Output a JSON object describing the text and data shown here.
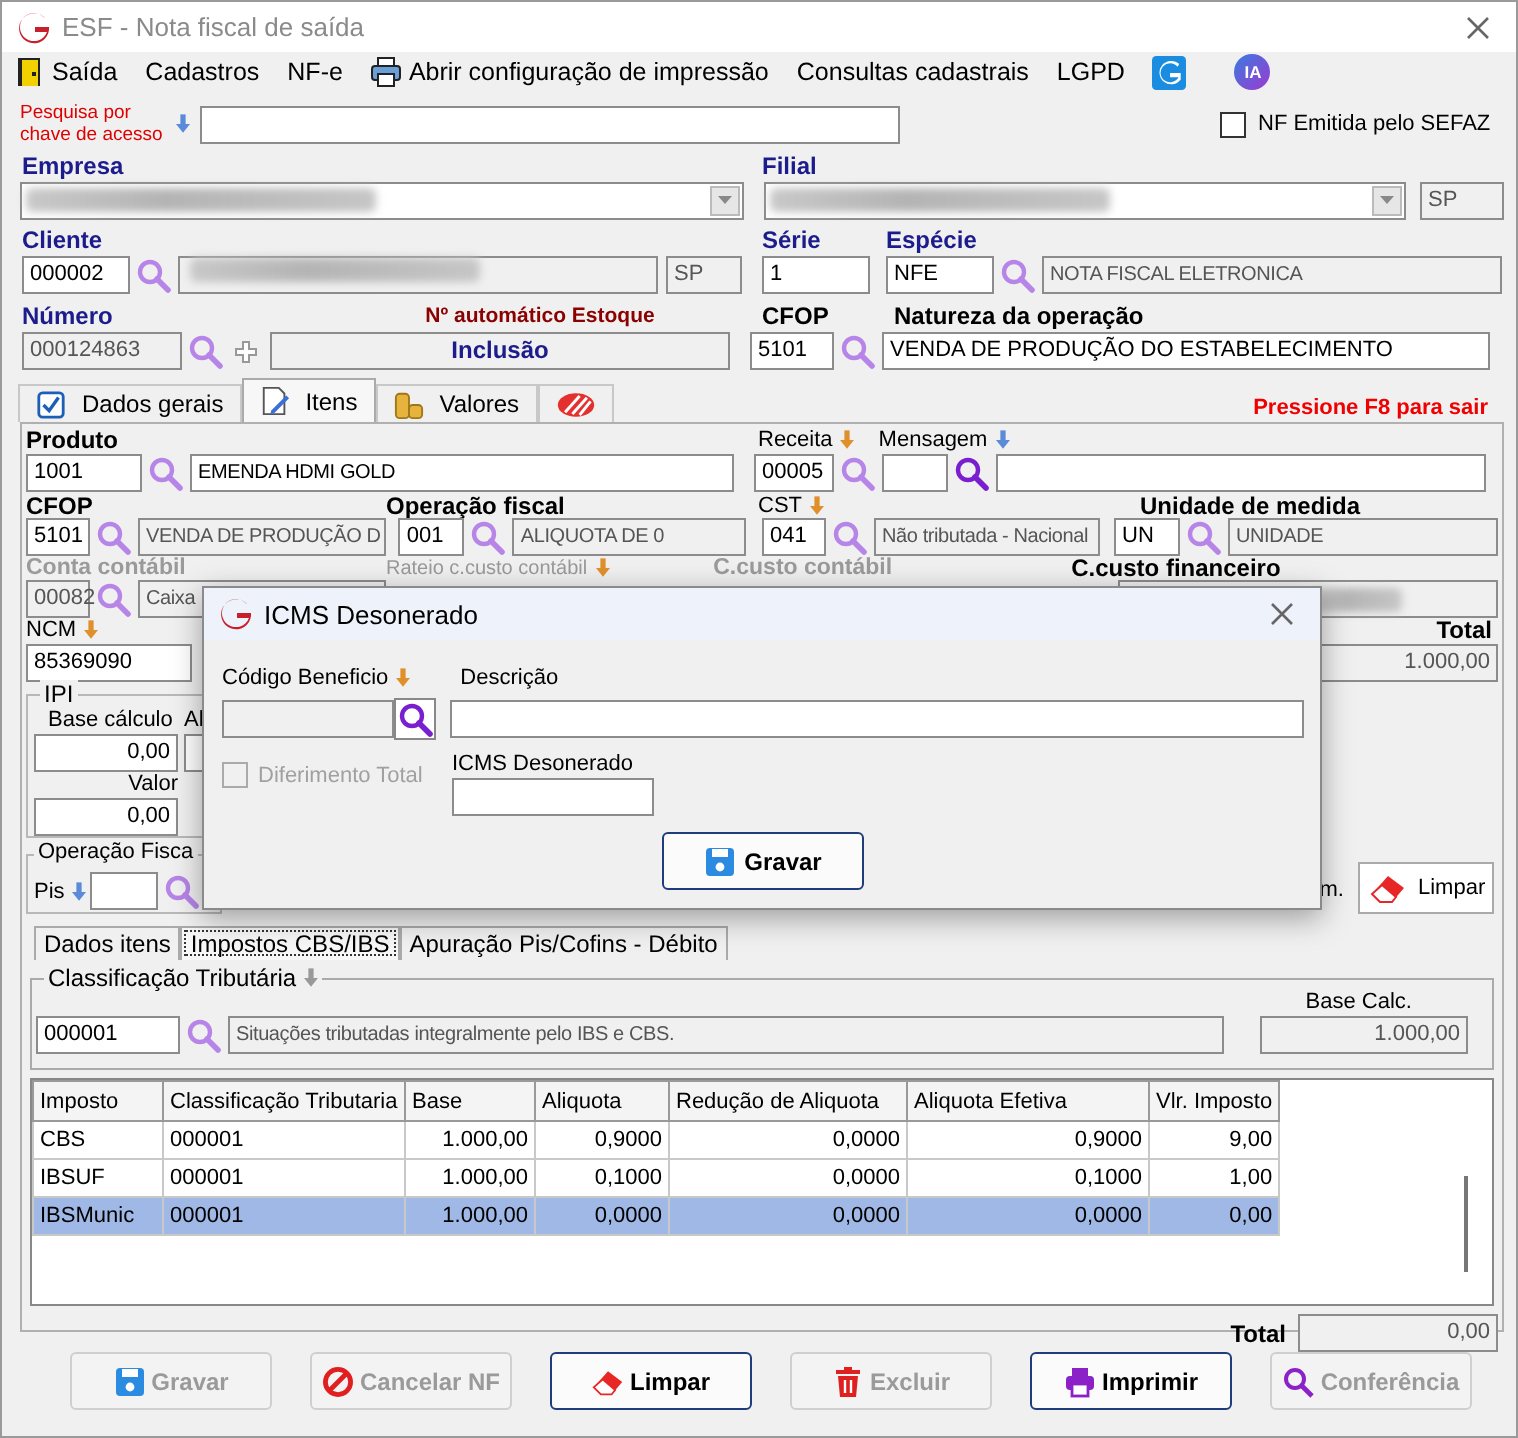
{
  "window": {
    "title": "ESF - Nota fiscal de saída"
  },
  "menu": [
    {
      "kind": "exit",
      "label": "Saída"
    },
    {
      "kind": "text",
      "label": "Cadastros"
    },
    {
      "kind": "text",
      "label": "NF-e"
    },
    {
      "kind": "print",
      "label": "Abrir configuração de impressão"
    },
    {
      "kind": "text",
      "label": "Consultas cadastrais"
    },
    {
      "kind": "text",
      "label": "LGPD"
    },
    {
      "kind": "logo"
    },
    {
      "kind": "badge",
      "label": "IA"
    }
  ],
  "access_key_search": {
    "label": "Pesquisa por chave de acesso"
  },
  "nf_emitida_sefaz": {
    "label": "NF Emitida pelo SEFAZ",
    "checked": false
  },
  "empresa": {
    "label": "Empresa"
  },
  "filial": {
    "label": "Filial",
    "uf": "SP"
  },
  "cliente": {
    "label": "Cliente",
    "code": "000002",
    "uf": "SP"
  },
  "serie": {
    "label": "Série",
    "value": "1"
  },
  "especie": {
    "label": "Espécie",
    "code": "NFE",
    "description": "NOTA FISCAL ELETRONICA"
  },
  "numero": {
    "label": "Número",
    "value": "000124863",
    "auto_label": "Nº automático Estoque",
    "mode": "Inclusão"
  },
  "cfop": {
    "label": "CFOP",
    "value": "5101"
  },
  "natureza": {
    "label": "Natureza da operação",
    "value": "VENDA DE PRODUÇÃO DO ESTABELECIMENTO"
  },
  "tabs": [
    {
      "kind": "check",
      "label": "Dados gerais",
      "selected": false
    },
    {
      "kind": "edit",
      "label": "Itens",
      "selected": true
    },
    {
      "kind": "coins",
      "label": "Valores",
      "selected": false
    },
    {
      "kind": "stripes",
      "selected": false
    }
  ],
  "exit_hint": "Pressione F8 para sair",
  "item": {
    "produto": {
      "label": "Produto",
      "code": "1001",
      "description": "EMENDA HDMI GOLD"
    },
    "receita": {
      "label": "Receita",
      "value": "00005"
    },
    "mensagem": {
      "label": "Mensagem"
    },
    "cfop": {
      "label": "CFOP",
      "code": "5101",
      "description": "VENDA DE PRODUÇÃO D"
    },
    "operacao_fiscal": {
      "label": "Operação fiscal",
      "code": "001",
      "description": "ALIQUOTA DE 0"
    },
    "cst": {
      "label": "CST",
      "code": "041",
      "description": "Não tributada - Nacional"
    },
    "unidade": {
      "label": "Unidade de medida",
      "code": "UN",
      "description": "UNIDADE"
    },
    "conta_contabil": {
      "label": "Conta contábil",
      "code": "00082",
      "description": "Caixa",
      "disabled": true
    },
    "rateio": {
      "label": "Rateio c.custo contábil"
    },
    "ccusto_contabil": {
      "label": "C.custo contábil",
      "disabled": true
    },
    "ccusto_financeiro": {
      "label": "C.custo financeiro"
    },
    "ncm": {
      "label": "NCM",
      "value": "85369090"
    },
    "total": {
      "label": "Total",
      "value": "1.000,00"
    },
    "ipi": {
      "title": "IPI",
      "base_label": "Base cálculo",
      "base": "0,00",
      "aliquota_label": "Al",
      "valor_label": "Valor",
      "valor": "0,00"
    },
    "operacao_fiscal_group": {
      "title": "Operação Fisca",
      "pis_label": "Pis"
    },
    "cut_label": "m.",
    "clear_button": "Limpar"
  },
  "subtabs": [
    {
      "label": "Dados itens",
      "selected": false
    },
    {
      "label": "Impostos CBS/IBS",
      "selected": true
    },
    {
      "label": "Apuração Pis/Cofins - Débito",
      "selected": false
    }
  ],
  "classificacao": {
    "title": "Classificação Tributária",
    "code": "000001",
    "description": "Situações tributadas integralmente pelo IBS e CBS.",
    "base_label": "Base Calc.",
    "base": "1.000,00"
  },
  "table": {
    "columns": [
      "Imposto",
      "Classificação Tributaria",
      "Base",
      "Aliquota",
      "Redução de Aliquota",
      "Aliquota Efetiva",
      "Vlr. Imposto"
    ],
    "rows": [
      {
        "cells": [
          "CBS",
          "000001",
          "1.000,00",
          "0,9000",
          "0,0000",
          "0,9000",
          "9,00"
        ],
        "selected": false
      },
      {
        "cells": [
          "IBSUF",
          "000001",
          "1.000,00",
          "0,1000",
          "0,0000",
          "0,1000",
          "1,00"
        ],
        "selected": false
      },
      {
        "cells": [
          "IBSMunic",
          "000001",
          "1.000,00",
          "0,0000",
          "0,0000",
          "0,0000",
          "0,00"
        ],
        "selected": true
      }
    ]
  },
  "total": {
    "label": "Total",
    "value": "0,00"
  },
  "buttons": [
    {
      "kind": "save",
      "label": "Gravar",
      "disabled": true
    },
    {
      "kind": "cancel",
      "label": "Cancelar NF",
      "disabled": true
    },
    {
      "kind": "eraser",
      "label": "Limpar",
      "disabled": false
    },
    {
      "kind": "trash",
      "label": "Excluir",
      "disabled": true
    },
    {
      "kind": "print",
      "label": "Imprimir",
      "disabled": false
    },
    {
      "kind": "search",
      "label": "Conferência",
      "disabled": true
    }
  ],
  "dialog": {
    "title": "ICMS Desonerado",
    "codigo_label": "Código Beneficio",
    "descricao_label": "Descrição",
    "diferimento": {
      "label": "Diferimento Total",
      "checked": false,
      "disabled": true
    },
    "icms_label": "ICMS Desonerado",
    "save_button": "Gravar"
  }
}
